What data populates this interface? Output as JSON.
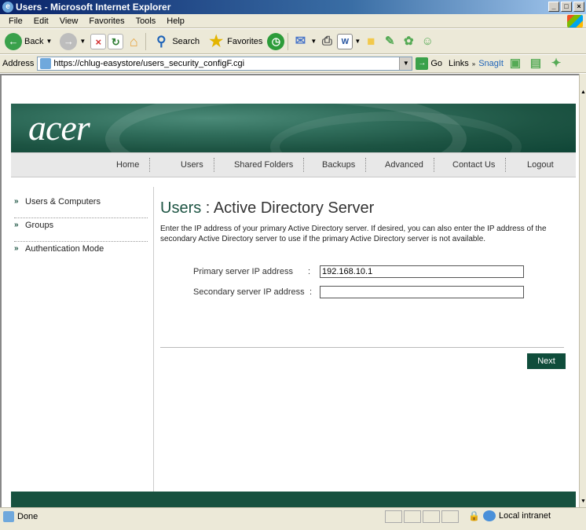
{
  "window": {
    "title": "Users - Microsoft Internet Explorer",
    "controls": [
      "_",
      "□",
      "×"
    ]
  },
  "menubar": {
    "items": [
      "File",
      "Edit",
      "View",
      "Favorites",
      "Tools",
      "Help"
    ]
  },
  "toolbar": {
    "back_label": "Back",
    "search_label": "Search",
    "favorites_label": "Favorites"
  },
  "address": {
    "label": "Address",
    "url": "https://chlug-easystore/users_security_configF.cgi",
    "go_label": "Go",
    "links_label": "Links",
    "snagit_label": "SnagIt"
  },
  "site": {
    "logo": "acer",
    "nav": [
      "Home",
      "Users",
      "Shared Folders",
      "Backups",
      "Advanced",
      "Contact Us",
      "Logout"
    ],
    "sidebar": [
      "Users & Computers",
      "Groups",
      "Authentication Mode"
    ]
  },
  "main": {
    "title_section": "Users",
    "title_sep": " : ",
    "title_page": "Active Directory Server",
    "intro": "Enter the IP address of your primary Active Directory server. If desired, you can also enter the IP address of the secondary Active Directory server to use if the primary Active Directory server is not available.",
    "primary_label": "Primary server IP address",
    "primary_value": "192.168.10.1",
    "secondary_label": "Secondary server IP address",
    "secondary_value": "",
    "colon": ":",
    "next_label": "Next"
  },
  "status": {
    "text": "Done",
    "zone": "Local intranet"
  }
}
